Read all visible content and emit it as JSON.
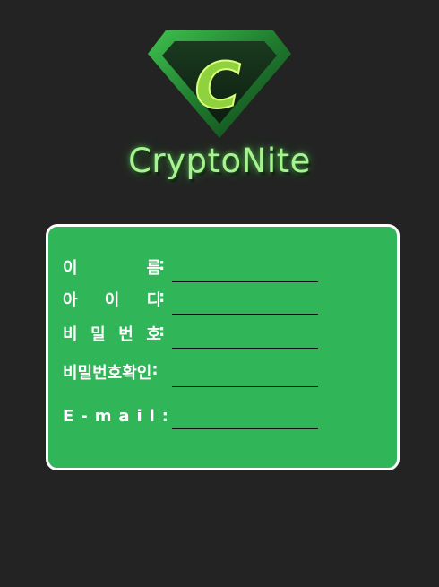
{
  "brand": {
    "logo_letter": "C",
    "title": "CryptoNite"
  },
  "icons": {
    "logo": "superman-diamond-c-logo-icon"
  },
  "colors": {
    "background": "#232323",
    "card": "#30b558",
    "card_border": "#ffffff",
    "title_glow": "#a6f38f",
    "logo_green": "#2f9e3f",
    "logo_letter": "#8fd13f"
  },
  "form": {
    "fields": [
      {
        "label_chars": [
          "이",
          "름",
          ":"
        ],
        "value": ""
      },
      {
        "label_chars": [
          "아",
          "이",
          "디",
          ":"
        ],
        "value": ""
      },
      {
        "label_chars": [
          "비",
          "밀",
          "번",
          "호",
          ":"
        ],
        "value": ""
      },
      {
        "label_chars": [
          "비밀번호확인",
          ":"
        ],
        "value": ""
      },
      {
        "label_chars": [
          "E",
          "-",
          "m",
          "a",
          "i",
          "l",
          ":"
        ],
        "value": ""
      }
    ]
  }
}
